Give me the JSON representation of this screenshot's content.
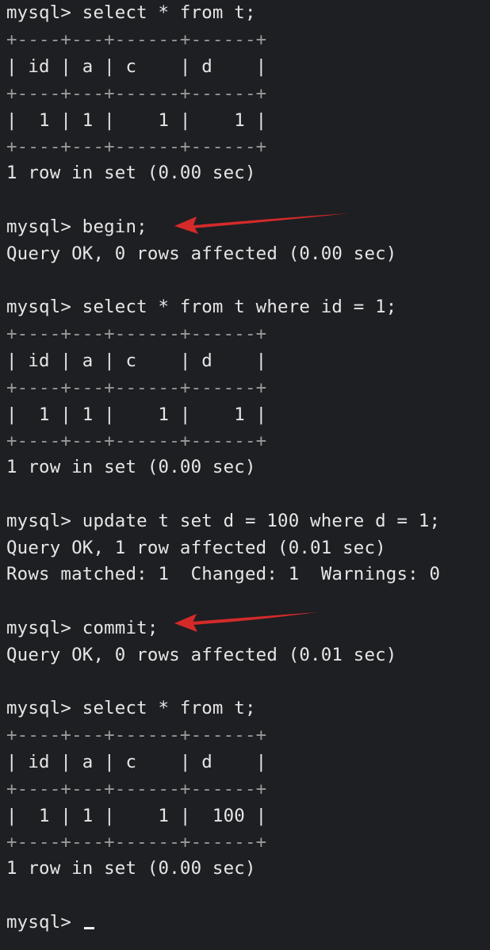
{
  "terminal": {
    "lines": [
      "mysql> select * from t;",
      "+----+---+------+------+",
      "| id | a | c    | d    |",
      "+----+---+------+------+",
      "|  1 | 1 |    1 |    1 |",
      "+----+---+------+------+",
      "1 row in set (0.00 sec)",
      "",
      "mysql> begin;",
      "Query OK, 0 rows affected (0.00 sec)",
      "",
      "mysql> select * from t where id = 1;",
      "+----+---+------+------+",
      "| id | a | c    | d    |",
      "+----+---+------+------+",
      "|  1 | 1 |    1 |    1 |",
      "+----+---+------+------+",
      "1 row in set (0.00 sec)",
      "",
      "mysql> update t set d = 100 where d = 1;",
      "Query OK, 1 row affected (0.01 sec)",
      "Rows matched: 1  Changed: 1  Warnings: 0",
      "",
      "mysql> commit;",
      "Query OK, 0 rows affected (0.01 sec)",
      "",
      "mysql> select * from t;",
      "+----+---+------+------+",
      "| id | a | c    | d    |",
      "+----+---+------+------+",
      "|  1 | 1 |    1 |  100 |",
      "+----+---+------+------+",
      "1 row in set (0.00 sec)",
      "",
      "mysql> "
    ]
  },
  "colors": {
    "background": "#1e1f22",
    "text": "#e6e6e6",
    "table_border": "#9a9a9a",
    "annotation_arrow": "#d42a2a"
  },
  "icons": {
    "annotation": "red-arrow-icon",
    "cursor": "text-cursor"
  }
}
